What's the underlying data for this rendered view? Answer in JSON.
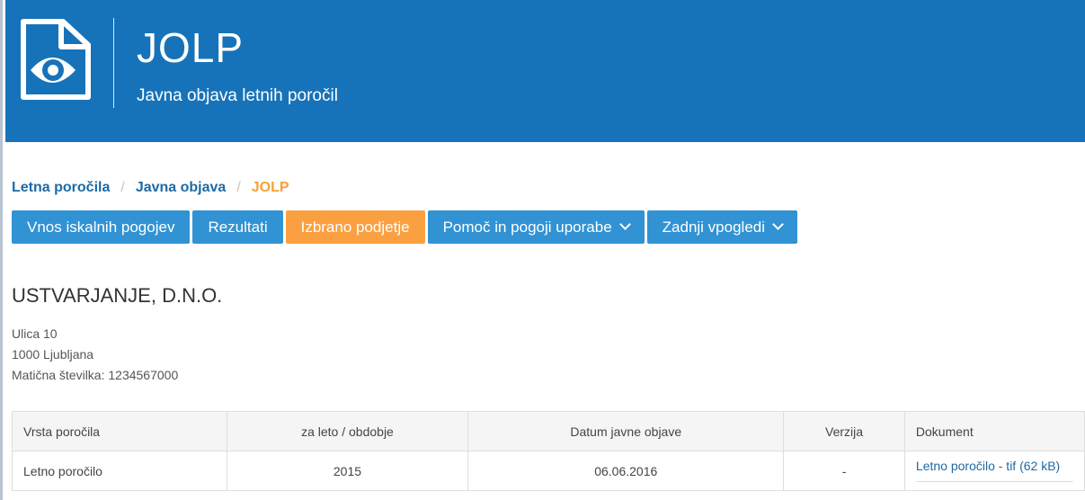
{
  "header": {
    "title": "JOLP",
    "subtitle": "Javna objava letnih poročil"
  },
  "breadcrumb": {
    "items": [
      "Letna poročila",
      "Javna objava"
    ],
    "current": "JOLP"
  },
  "nav": {
    "search": "Vnos iskalnih pogojev",
    "results": "Rezultati",
    "selected": "Izbrano podjetje",
    "help": "Pomoč in pogoji uporabe",
    "recent": "Zadnji vpogledi"
  },
  "company": {
    "name": "USTVARJANJE, D.N.O.",
    "street": "Ulica 10",
    "city": "1000 Ljubljana",
    "reg_number": "Matična številka: 1234567000"
  },
  "table": {
    "headers": [
      "Vrsta poročila",
      "za leto / obdobje",
      "Datum javne objave",
      "Verzija",
      "Dokument"
    ],
    "rows": [
      {
        "type": "Letno poročilo",
        "year": "2015",
        "date": "06.06.2016",
        "version": "-",
        "document": "Letno poročilo - tif (62 kB)"
      }
    ]
  },
  "colors": {
    "header_bg": "#1773b9",
    "nav_bg": "#3192d4",
    "accent": "#fba041",
    "link": "#1d6aa5"
  }
}
